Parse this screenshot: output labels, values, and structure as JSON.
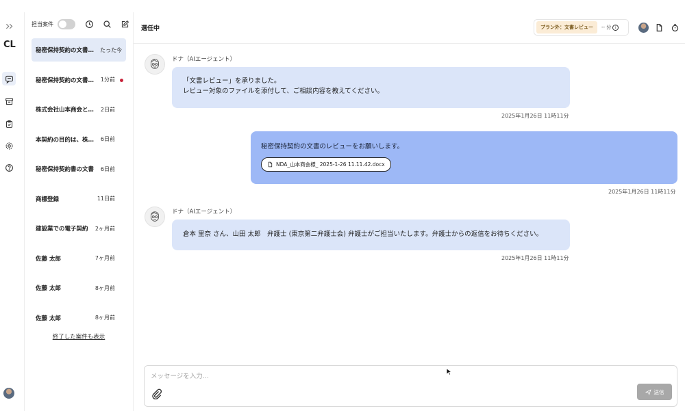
{
  "rail": {
    "logo": "CL",
    "icons": [
      "expand-icon",
      "chat-icon",
      "archive-icon",
      "clipboard-icon",
      "settings-icon",
      "help-icon"
    ]
  },
  "case_panel": {
    "filter_label": "担当案件",
    "items": [
      {
        "title": "秘密保持契約の文書のレビュー",
        "time": "たった今",
        "selected": true,
        "unread": false
      },
      {
        "title": "秘密保持契約の文書のレビュー",
        "time": "1分前",
        "selected": false,
        "unread": true
      },
      {
        "title": "株式会社山本商会との契約",
        "time": "2日前",
        "selected": false,
        "unread": false
      },
      {
        "title": "本契約の目的は、株式会社",
        "time": "6日前",
        "selected": false,
        "unread": false
      },
      {
        "title": "秘密保持契約書の文書",
        "time": "6日前",
        "selected": false,
        "unread": false
      },
      {
        "title": "商標登録",
        "time": "11日前",
        "selected": false,
        "unread": false
      },
      {
        "title": "建設業での電子契約",
        "time": "2ヶ月前",
        "selected": false,
        "unread": false
      },
      {
        "title": "佐藤 太郎",
        "time": "7ヶ月前",
        "selected": false,
        "unread": false
      },
      {
        "title": "佐藤 太郎",
        "time": "8ヶ月前",
        "selected": false,
        "unread": false
      },
      {
        "title": "佐藤 太郎",
        "time": "8ヶ月前",
        "selected": false,
        "unread": false
      }
    ],
    "show_ended_link": "終了した案件も表示"
  },
  "header": {
    "status": "選任中",
    "plan_badge": "プラン外：文書レビュー",
    "minutes": "-- 分",
    "info_glyph": "i"
  },
  "messages": {
    "agent_name": "ドナ（AIエージェント）",
    "m1_line1": "「文書レビュー」を承りました。",
    "m1_line2": "レビュー対象のファイルを添付して、ご相談内容を教えてください。",
    "m1_time": "2025年1月26日 11時11分",
    "m2_text": "秘密保持契約の文書のレビューをお願いします。",
    "m2_file": "NDA_山本商会様_ 2025-1-26 11.11.42.docx",
    "m2_time": "2025年1月26日 11時11分",
    "m3_text": "倉本 里奈 さん、山田 太郎　弁護士 (東京第二弁護士会) 弁護士がご担当いたします。弁護士からの返信をお待ちください。",
    "m3_time": "2025年1月26日 11時11分"
  },
  "composer": {
    "placeholder": "メッセージを入力...",
    "value": "",
    "send_label": "送信"
  },
  "colors": {
    "agent_bubble": "#dbe5f9",
    "user_bubble": "#9db8f6",
    "selected_case": "#e3eaf7",
    "unread_dot": "#c8243b",
    "plan_badge_bg": "#fbecd6",
    "send_disabled": "#a8a8a8"
  }
}
